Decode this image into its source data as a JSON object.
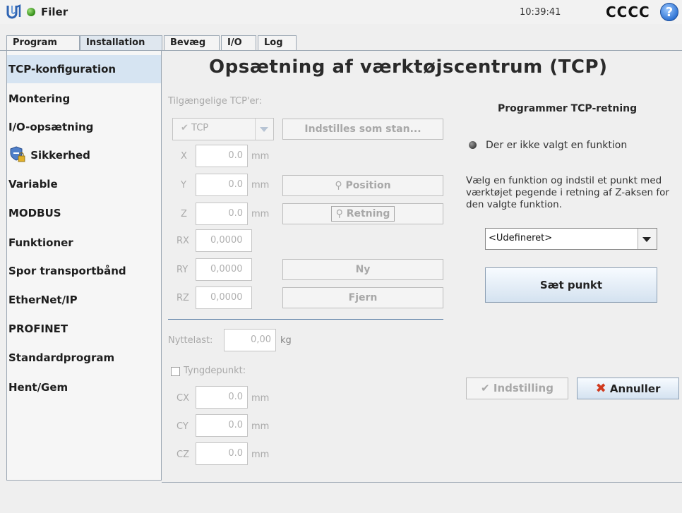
{
  "topbar": {
    "title": "Filer",
    "time": "10:39:41",
    "robot_name": "CCCC",
    "help_symbol": "?"
  },
  "tabs": [
    {
      "label": "Program"
    },
    {
      "label": "Installation",
      "active": true
    },
    {
      "label": "Bevæg"
    },
    {
      "label": "I/O"
    },
    {
      "label": "Log"
    }
  ],
  "sidebar": {
    "items": [
      {
        "label": "TCP-konfiguration",
        "active": true
      },
      {
        "label": "Montering"
      },
      {
        "label": "I/O-opsætning"
      },
      {
        "label": "Sikkerhed",
        "icon": "shield-lock-icon"
      },
      {
        "label": "Variable"
      },
      {
        "label": "MODBUS"
      },
      {
        "label": "Funktioner"
      },
      {
        "label": "Spor transportbånd"
      },
      {
        "label": "EtherNet/IP"
      },
      {
        "label": "PROFINET"
      },
      {
        "label": "Standardprogram"
      },
      {
        "label": "Hent/Gem"
      }
    ]
  },
  "main": {
    "title": "Opsætning af værktøjscentrum (TCP)",
    "available_label": "Tilgængelige TCP'er:",
    "tcp_select_value": "TCP",
    "set_default_label": "Indstilles som stan...",
    "fields": {
      "x": {
        "label": "X",
        "value": "0.0",
        "unit": "mm"
      },
      "y": {
        "label": "Y",
        "value": "0.0",
        "unit": "mm"
      },
      "z": {
        "label": "Z",
        "value": "0.0",
        "unit": "mm"
      },
      "rx": {
        "label": "RX",
        "value": "0,0000"
      },
      "ry": {
        "label": "RY",
        "value": "0,0000"
      },
      "rz": {
        "label": "RZ",
        "value": "0,0000"
      }
    },
    "position_label": "Position",
    "direction_label": "Retning",
    "new_label": "Ny",
    "remove_label": "Fjern",
    "payload": {
      "label": "Nyttelast:",
      "value": "0,00",
      "unit": "kg"
    },
    "cog": {
      "label": "Tyngdepunkt:",
      "cx": {
        "label": "CX",
        "value": "0.0",
        "unit": "mm"
      },
      "cy": {
        "label": "CY",
        "value": "0.0",
        "unit": "mm"
      },
      "cz": {
        "label": "CZ",
        "value": "0.0",
        "unit": "mm"
      }
    }
  },
  "right": {
    "title": "Programmer TCP-retning",
    "status": "Der er ikke valgt en funktion",
    "description": "Vælg en funktion og indstil et punkt med værktøjet pegende i retning af Z-aksen for den valgte funktion.",
    "feature_select": "<Udefineret>",
    "set_point_label": "Sæt punkt",
    "settings_label": "Indstilling",
    "cancel_label": "Annuller"
  },
  "colors": {
    "accent": "#d6e4f2",
    "separator": "#5a7ea6",
    "cancel_icon": "#d03a1e"
  }
}
